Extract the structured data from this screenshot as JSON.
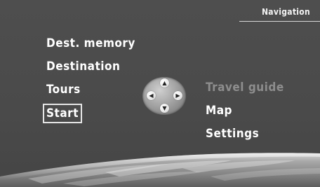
{
  "header": {
    "title": "Navigation"
  },
  "menu_left": [
    {
      "label": "Dest. memory",
      "selected": false
    },
    {
      "label": "Destination",
      "selected": false
    },
    {
      "label": "Tours",
      "selected": false
    },
    {
      "label": "Start",
      "selected": true
    }
  ],
  "menu_right": [
    {
      "label": "Travel guide",
      "enabled": false
    },
    {
      "label": "Map",
      "enabled": true
    },
    {
      "label": "Settings",
      "enabled": true
    }
  ],
  "joystick": {
    "up_icon": "arrow-up-icon",
    "down_icon": "arrow-down-icon",
    "left_icon": "arrow-left-icon",
    "right_icon": "arrow-right-icon"
  },
  "colors": {
    "background": "#4a4a4a",
    "text": "#ffffff",
    "disabled_text": "#8d8d8d"
  }
}
